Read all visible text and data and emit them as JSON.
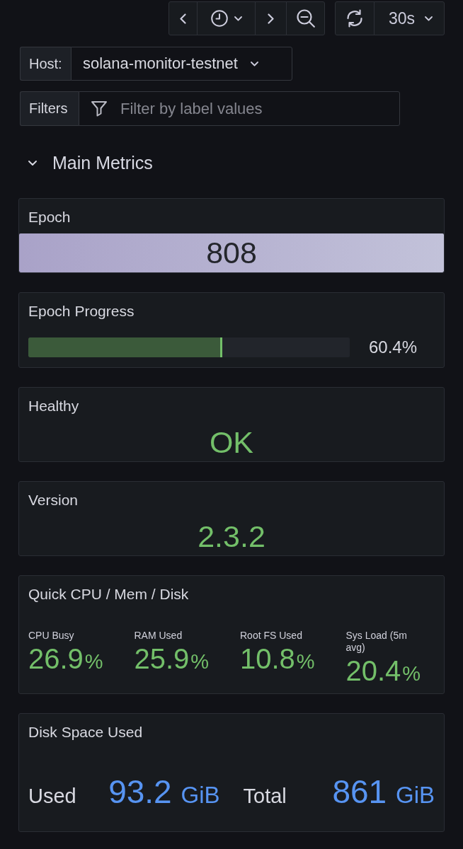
{
  "toolbar": {
    "refresh_interval": "30s"
  },
  "variables": [
    {
      "kind": "select",
      "label": "Host:",
      "value": "solana-monitor-testnet"
    },
    {
      "kind": "filter",
      "label": "Filters",
      "placeholder": "Filter by label values"
    }
  ],
  "row": {
    "title": "Main Metrics",
    "expanded": true
  },
  "panels": [
    {
      "kind": "background_stat",
      "title": "Epoch",
      "value": "808",
      "color": "#a9a2c8"
    },
    {
      "kind": "bar_gauge",
      "title": "Epoch Progress",
      "level": 0.604,
      "reading": "60.4%"
    },
    {
      "kind": "stat",
      "title": "Healthy",
      "value": "OK",
      "color": "#73bf69"
    },
    {
      "kind": "stat",
      "title": "Version",
      "value": "2.3.2",
      "color": "#73bf69"
    },
    {
      "kind": "multi_stat",
      "title": "Quick CPU / Mem / Disk",
      "stats": [
        {
          "label": "CPU Busy",
          "value": "26.9",
          "unit": "%",
          "color": "#73bf69"
        },
        {
          "label": "RAM Used",
          "value": "25.9",
          "unit": "%",
          "color": "#73bf69"
        },
        {
          "label": "Root FS Used",
          "value": "10.8",
          "unit": "%",
          "color": "#73bf69"
        },
        {
          "label": "Sys Load (5m avg)",
          "value": "20.4",
          "unit": "%",
          "color": "#73bf69"
        }
      ]
    },
    {
      "kind": "labeled_pair",
      "title": "Disk Space Used",
      "stats": [
        {
          "label": "Used",
          "value": "93.2",
          "unit": "GiB",
          "color": "#5794f2"
        },
        {
          "label": "Total",
          "value": "861",
          "unit": "GiB",
          "color": "#5794f2"
        }
      ]
    }
  ]
}
